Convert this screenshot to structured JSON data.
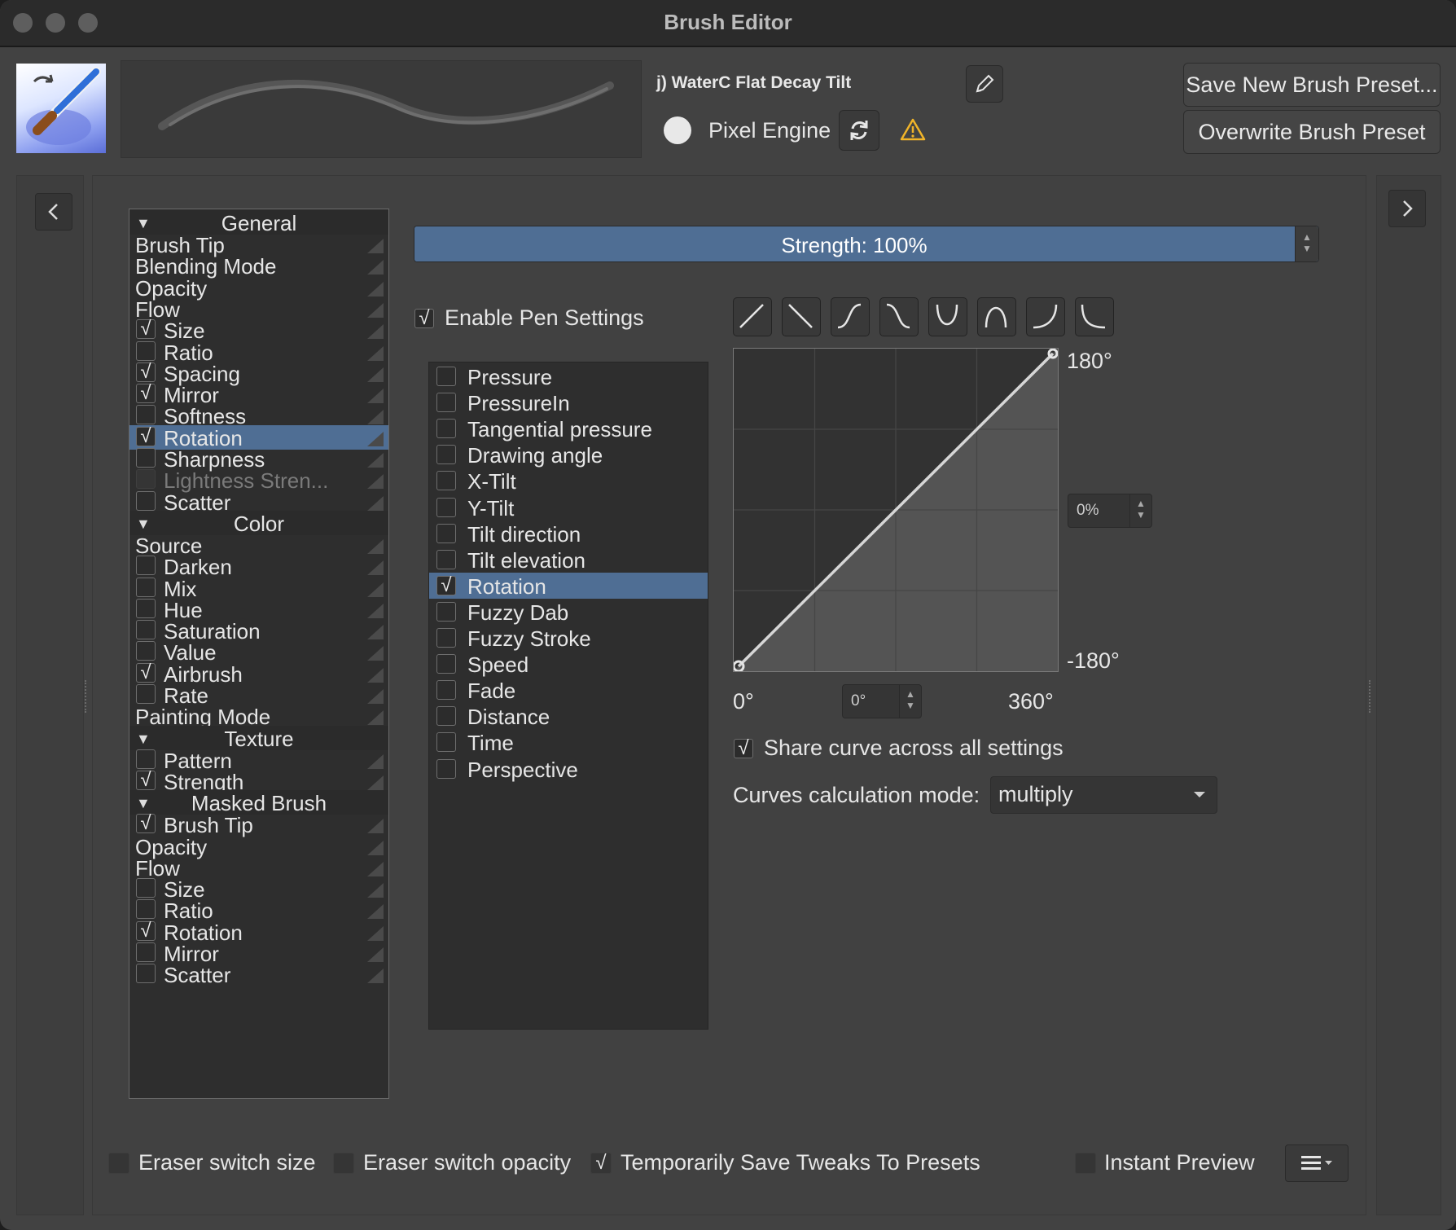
{
  "window": {
    "title": "Brush Editor"
  },
  "header": {
    "preset_name": "j) WaterC Flat Decay Tilt",
    "engine": "Pixel Engine",
    "save_new_label": "Save New Brush Preset...",
    "overwrite_label": "Overwrite Brush Preset"
  },
  "tree": {
    "rows": [
      {
        "type": "section",
        "label": "General"
      },
      {
        "type": "item",
        "label": "Brush Tip",
        "checkbox": false
      },
      {
        "type": "item",
        "label": "Blending Mode",
        "checkbox": false
      },
      {
        "type": "item",
        "label": "Opacity",
        "checkbox": false
      },
      {
        "type": "item",
        "label": "Flow",
        "checkbox": false
      },
      {
        "type": "item",
        "label": "Size",
        "checkbox": true,
        "checked": true
      },
      {
        "type": "item",
        "label": "Ratio",
        "checkbox": true,
        "checked": false
      },
      {
        "type": "item",
        "label": "Spacing",
        "checkbox": true,
        "checked": true
      },
      {
        "type": "item",
        "label": "Mirror",
        "checkbox": true,
        "checked": true
      },
      {
        "type": "item",
        "label": "Softness",
        "checkbox": true,
        "checked": false
      },
      {
        "type": "item",
        "label": "Rotation",
        "checkbox": true,
        "checked": true,
        "selected": true
      },
      {
        "type": "item",
        "label": "Sharpness",
        "checkbox": true,
        "checked": false
      },
      {
        "type": "item",
        "label": "Lightness Stren...",
        "checkbox": true,
        "checked": false,
        "disabled": true
      },
      {
        "type": "item",
        "label": "Scatter",
        "checkbox": true,
        "checked": false
      },
      {
        "type": "section",
        "label": "Color"
      },
      {
        "type": "item",
        "label": "Source",
        "checkbox": false
      },
      {
        "type": "item",
        "label": "Darken",
        "checkbox": true,
        "checked": false
      },
      {
        "type": "item",
        "label": "Mix",
        "checkbox": true,
        "checked": false
      },
      {
        "type": "item",
        "label": "Hue",
        "checkbox": true,
        "checked": false
      },
      {
        "type": "item",
        "label": "Saturation",
        "checkbox": true,
        "checked": false
      },
      {
        "type": "item",
        "label": "Value",
        "checkbox": true,
        "checked": false
      },
      {
        "type": "item",
        "label": "Airbrush",
        "checkbox": true,
        "checked": true
      },
      {
        "type": "item",
        "label": "Rate",
        "checkbox": true,
        "checked": false
      },
      {
        "type": "item",
        "label": "Painting Mode",
        "checkbox": false
      },
      {
        "type": "section",
        "label": "Texture"
      },
      {
        "type": "item",
        "label": "Pattern",
        "checkbox": true,
        "checked": false
      },
      {
        "type": "item",
        "label": "Strength",
        "checkbox": true,
        "checked": true
      },
      {
        "type": "section",
        "label": "Masked Brush"
      },
      {
        "type": "item",
        "label": "Brush Tip",
        "checkbox": true,
        "checked": true
      },
      {
        "type": "item",
        "label": "Opacity",
        "checkbox": false
      },
      {
        "type": "item",
        "label": "Flow",
        "checkbox": false
      },
      {
        "type": "item",
        "label": "Size",
        "checkbox": true,
        "checked": false
      },
      {
        "type": "item",
        "label": "Ratio",
        "checkbox": true,
        "checked": false
      },
      {
        "type": "item",
        "label": "Rotation",
        "checkbox": true,
        "checked": true
      },
      {
        "type": "item",
        "label": "Mirror",
        "checkbox": true,
        "checked": false
      },
      {
        "type": "item",
        "label": "Scatter",
        "checkbox": true,
        "checked": false
      }
    ]
  },
  "strength": {
    "label": "Strength: 100%",
    "value": 1.0
  },
  "pen": {
    "enable_label": "Enable Pen Settings",
    "enabled": true
  },
  "sensors": [
    {
      "label": "Pressure",
      "checked": false
    },
    {
      "label": "PressureIn",
      "checked": false
    },
    {
      "label": "Tangential pressure",
      "checked": false
    },
    {
      "label": "Drawing angle",
      "checked": false
    },
    {
      "label": "X-Tilt",
      "checked": false
    },
    {
      "label": "Y-Tilt",
      "checked": false
    },
    {
      "label": "Tilt direction",
      "checked": false
    },
    {
      "label": "Tilt elevation",
      "checked": false
    },
    {
      "label": "Rotation",
      "checked": true,
      "selected": true
    },
    {
      "label": "Fuzzy Dab",
      "checked": false
    },
    {
      "label": "Fuzzy Stroke",
      "checked": false
    },
    {
      "label": "Speed",
      "checked": false
    },
    {
      "label": "Fade",
      "checked": false
    },
    {
      "label": "Distance",
      "checked": false
    },
    {
      "label": "Time",
      "checked": false
    },
    {
      "label": "Perspective",
      "checked": false
    }
  ],
  "curve_presets": [
    "linear-up-icon",
    "linear-down-icon",
    "s-curve-icon",
    "reverse-s-curve-icon",
    "u-curve-icon",
    "arch-curve-icon",
    "j-curve-icon",
    "l-curve-icon"
  ],
  "curve": {
    "y_max": "180°",
    "y_min": "-180°",
    "x_min": "0°",
    "x_max": "360°",
    "y_value": "0%",
    "x_value": "0°",
    "points": [
      [
        0,
        0
      ],
      [
        1,
        1
      ]
    ]
  },
  "share_curve": {
    "label": "Share curve across all settings",
    "checked": true
  },
  "calc_mode": {
    "label": "Curves calculation mode:",
    "value": "multiply"
  },
  "footer": {
    "eraser_size": {
      "label": "Eraser switch size",
      "checked": false
    },
    "eraser_opacity": {
      "label": "Eraser switch opacity",
      "checked": false
    },
    "temp_save": {
      "label": "Temporarily Save Tweaks To Presets",
      "checked": true
    },
    "instant_preview": {
      "label": "Instant Preview",
      "checked": false
    }
  },
  "colors": {
    "selection": "#4f6e94",
    "warning": "#f0b429"
  }
}
